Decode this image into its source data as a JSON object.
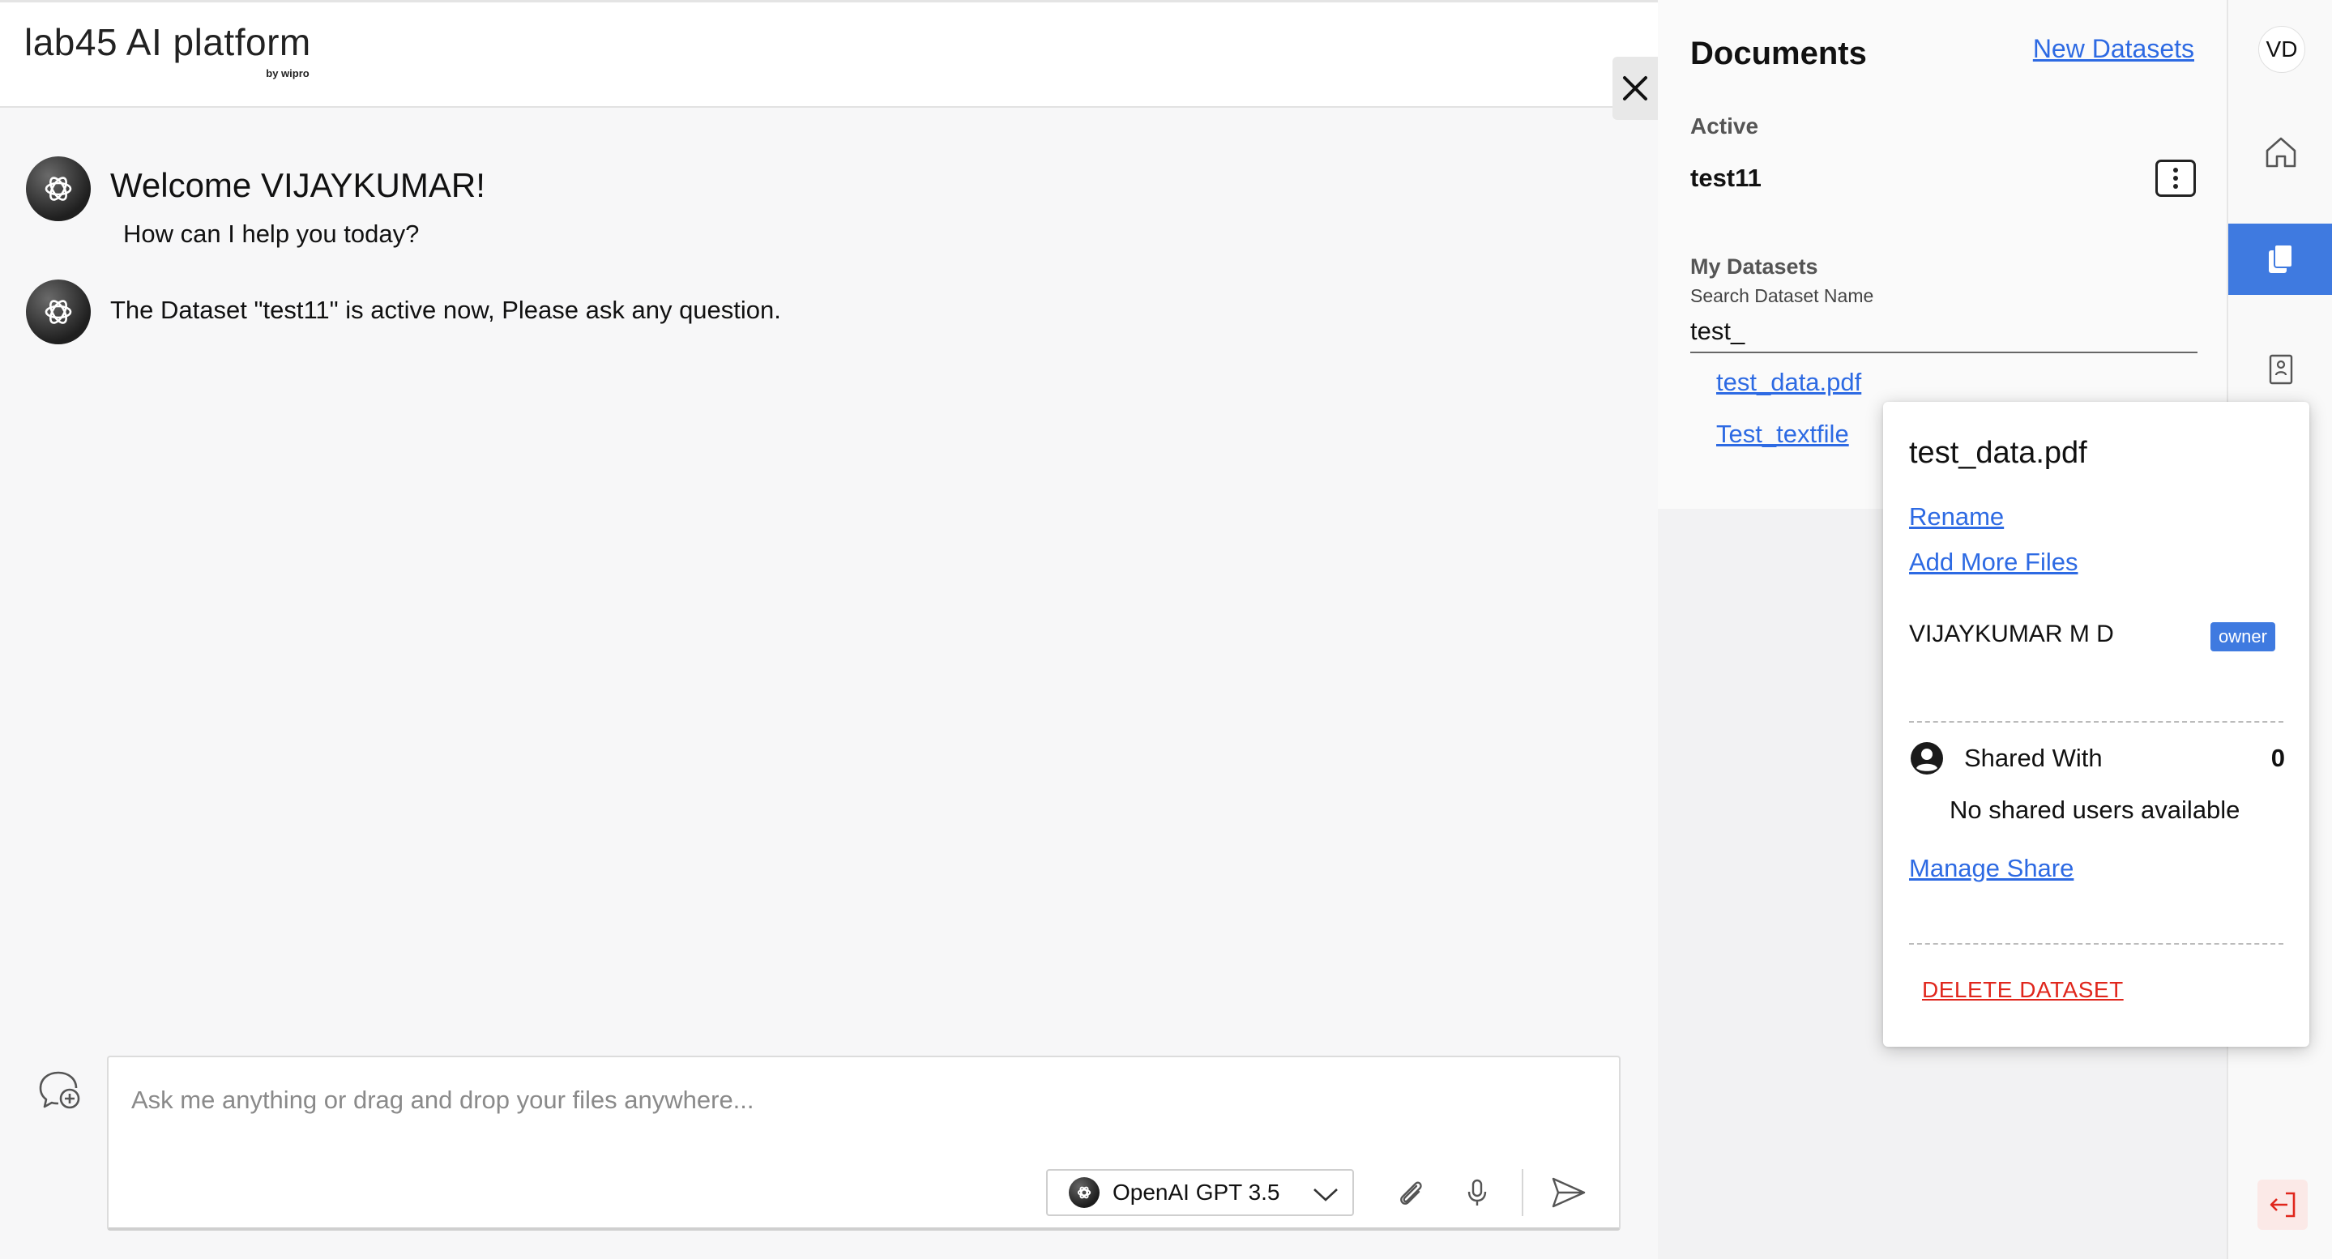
{
  "brand": {
    "name": "lab45 AI platform",
    "sub": "by wipro"
  },
  "chat": {
    "welcome": "Welcome VIJAYKUMAR!",
    "help": "How can I help you today?",
    "dataset_message": "The Dataset \"test11\" is active now, Please ask any question."
  },
  "composer": {
    "placeholder": "Ask me anything or drag and drop your files anywhere...",
    "model_label": "OpenAI GPT 3.5"
  },
  "documents": {
    "title": "Documents",
    "new_datasets": "New Datasets",
    "active_label": "Active",
    "active_name": "test11",
    "my_datasets_label": "My Datasets",
    "search_label": "Search Dataset Name",
    "search_value": "test_",
    "items": [
      {
        "label": "test_data.pdf"
      },
      {
        "label": "Test_textfile"
      }
    ]
  },
  "popover": {
    "title": "test_data.pdf",
    "rename": "Rename",
    "add_more_files": "Add More Files",
    "owner_name": "VIJAYKUMAR M D",
    "owner_badge": "owner",
    "shared_with_label": "Shared With",
    "shared_count": "0",
    "no_shared": "No shared users available",
    "manage_share": "Manage Share",
    "delete": "DELETE DATASET"
  },
  "rail": {
    "user_initials": "VD",
    "items": [
      {
        "icon": "home-icon"
      },
      {
        "icon": "documents-icon",
        "active": true
      },
      {
        "icon": "person-badge-icon"
      },
      {
        "icon": "logout-icon"
      }
    ]
  },
  "colors": {
    "accent": "#3f7ae0",
    "link": "#2d6ae3",
    "danger": "#e0261c"
  }
}
